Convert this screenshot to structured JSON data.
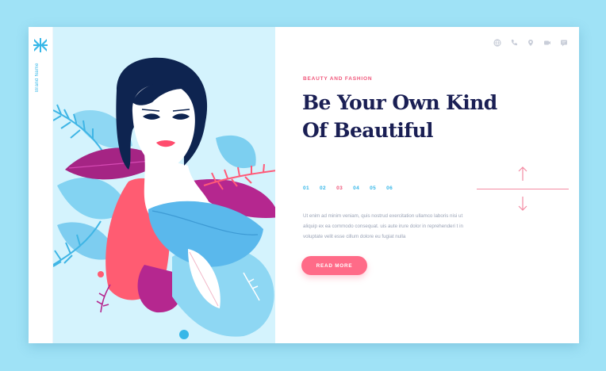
{
  "brand": {
    "name": "Brand Name",
    "logo_icon": "cross-x-logo-icon",
    "color": "#36b7e8"
  },
  "top_icons": [
    "globe-icon",
    "phone-icon",
    "location-pin-icon",
    "video-icon",
    "chat-icon"
  ],
  "hero": {
    "eyebrow": "BEAUTY AND FASHION",
    "headline_line1": "Be Your Own Kind",
    "headline_line2": "Of Beautiful",
    "body": "Ut enim ad minim veniam, quis nostrud exercitation ullamco laboris nisi ut aliquip ex ea commodo consequat. uis aute irure dolor in reprehenderi t in voluptate velit esse cillum dolore eu fugiat nulla",
    "cta_label": "READ MORE"
  },
  "pager": {
    "items": [
      "01",
      "02",
      "03",
      "04",
      "05",
      "06"
    ],
    "active_index": 2
  },
  "colors": {
    "background": "#9fe2f6",
    "accent_pink": "#f0567a",
    "button": "#ff6b88",
    "headline": "#1a1f54",
    "art_panel": "#d4f3fd",
    "brand_blue": "#36b7e8",
    "purple": "#b5278f"
  }
}
